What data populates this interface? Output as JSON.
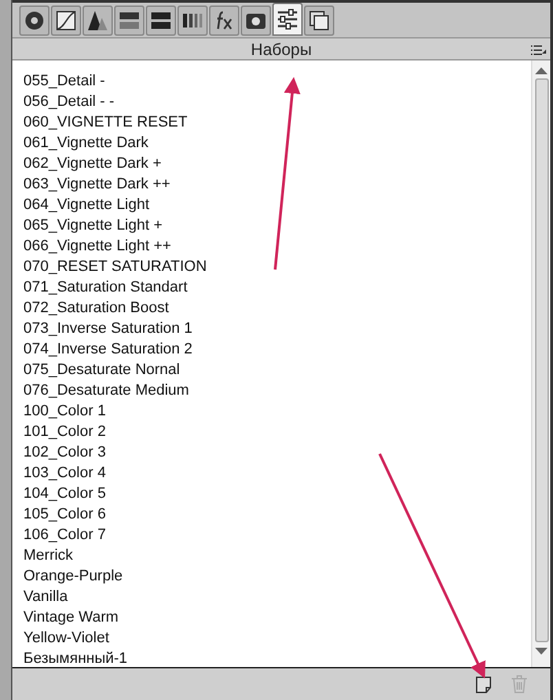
{
  "toolbar_tabs": [
    {
      "selected": false
    },
    {
      "selected": false
    },
    {
      "selected": false
    },
    {
      "selected": false
    },
    {
      "selected": false
    },
    {
      "selected": false
    },
    {
      "selected": false
    },
    {
      "selected": false
    },
    {
      "selected": true
    },
    {
      "selected": false
    }
  ],
  "panel": {
    "title": "Наборы"
  },
  "presets": [
    "055_Detail -",
    "056_Detail - -",
    "060_VIGNETTE RESET",
    "061_Vignette Dark",
    "062_Vignette Dark +",
    "063_Vignette Dark ++",
    "064_Vignette Light",
    "065_Vignette Light +",
    "066_Vignette Light ++",
    "070_RESET SATURATION",
    "071_Saturation Standart",
    "072_Saturation Boost",
    "073_Inverse Saturation 1",
    "074_Inverse Saturation 2",
    "075_Desaturate Nornal",
    "076_Desaturate Medium",
    "100_Color 1",
    "101_Color 2",
    "102_Color 3",
    "103_Color 4",
    "104_Color 5",
    "105_Color 6",
    "106_Color 7",
    "Merrick",
    "Orange-Purple",
    "Vanilla",
    "Vintage Warm",
    "Yellow-Violet",
    "Безымянный-1"
  ]
}
